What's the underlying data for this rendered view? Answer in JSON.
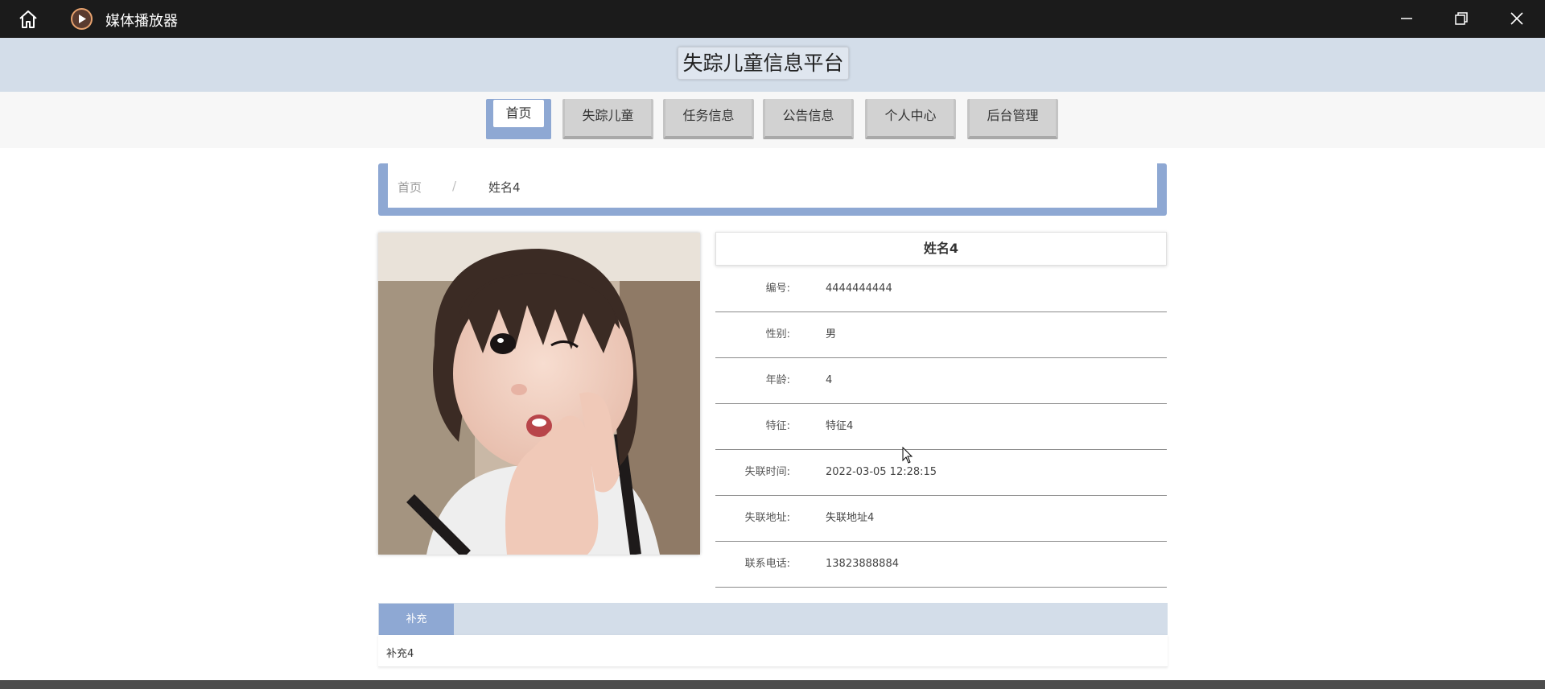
{
  "window": {
    "title": "媒体播放器"
  },
  "site": {
    "title": "失踪儿童信息平台"
  },
  "nav": {
    "items": [
      {
        "label": "首页",
        "active": true
      },
      {
        "label": "失踪儿童",
        "active": false
      },
      {
        "label": "任务信息",
        "active": false
      },
      {
        "label": "公告信息",
        "active": false
      },
      {
        "label": "个人中心",
        "active": false
      },
      {
        "label": "后台管理",
        "active": false
      }
    ]
  },
  "breadcrumb": {
    "home": "首页",
    "separator": "/",
    "current": "姓名4"
  },
  "detail": {
    "name": "姓名4",
    "fields": [
      {
        "label": "编号:",
        "value": "4444444444"
      },
      {
        "label": "性别:",
        "value": "男"
      },
      {
        "label": "年龄:",
        "value": "4"
      },
      {
        "label": "特征:",
        "value": "特征4"
      },
      {
        "label": "失联时间:",
        "value": "2022-03-05 12:28:15"
      },
      {
        "label": "失联地址:",
        "value": "失联地址4"
      },
      {
        "label": "联系电话:",
        "value": "13823888884"
      }
    ]
  },
  "supplement": {
    "tab_label": "补充",
    "text": "补充4"
  },
  "colors": {
    "accent": "#8ea8d3",
    "header_bg": "#d3dde9",
    "titlebar_bg": "#1b1b1b"
  }
}
